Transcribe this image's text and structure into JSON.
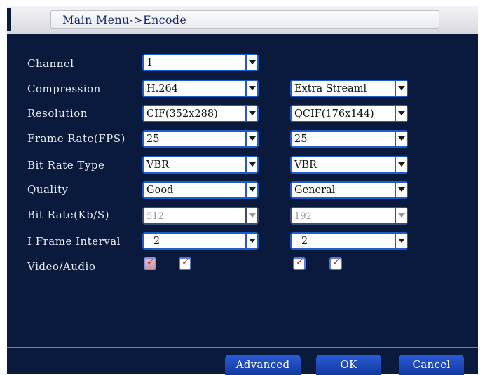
{
  "title": "Main Menu->Encode",
  "labels": {
    "channel": "Channel",
    "compression": "Compression",
    "resolution": "Resolution",
    "frame_rate": "Frame Rate(FPS)",
    "bit_rate_type": "Bit Rate Type",
    "quality": "Quality",
    "bit_rate": "Bit Rate(Kb/S)",
    "i_frame_interval": "I Frame Interval",
    "video_audio": "Video/Audio"
  },
  "main_stream": {
    "channel": "1",
    "compression": "H.264",
    "resolution": "CIF(352x288)",
    "frame_rate": "25",
    "bit_rate_type": "VBR",
    "quality": "Good",
    "bit_rate": "512",
    "i_frame_interval": "2",
    "video_checked": true,
    "audio_checked": true
  },
  "extra_stream": {
    "compression": "Extra Streaml",
    "resolution": "QCIF(176x144)",
    "frame_rate": "25",
    "bit_rate_type": "VBR",
    "quality": "General",
    "bit_rate": "192",
    "i_frame_interval": "2",
    "video_checked": true,
    "audio_checked": true
  },
  "buttons": {
    "advanced": "Advanced",
    "ok": "OK",
    "cancel": "Cancel"
  },
  "check_mark": "✓",
  "colors": {
    "background": "#0a1a3c",
    "accent_border": "#1e5cc8",
    "button": "#1e4ab8",
    "check": "#d02020"
  }
}
